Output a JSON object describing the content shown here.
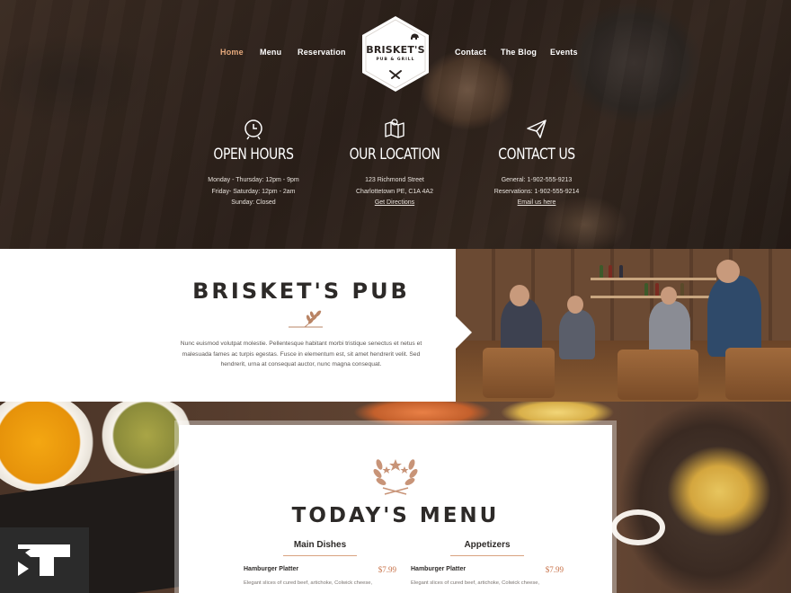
{
  "nav": {
    "left": [
      "Home",
      "Menu",
      "Reservation"
    ],
    "right": [
      "Contact",
      "The Blog",
      "Events"
    ]
  },
  "logo": {
    "name": "BRISKET'S",
    "tagline": "PUB & GRILL"
  },
  "info": [
    {
      "icon": "clock-icon",
      "title": "OPEN HOURS",
      "lines": [
        "Monday - Thursday: 12pm - 9pm",
        "Friday- Saturday: 12pm - 2am",
        "Sunday: Closed"
      ],
      "link": ""
    },
    {
      "icon": "map-icon",
      "title": "OUR LOCATION",
      "lines": [
        "123 Richmond Street",
        "Charlottetown PE, C1A 4A2"
      ],
      "link": "Get Directions"
    },
    {
      "icon": "paper-plane-icon",
      "title": "CONTACT US",
      "lines": [
        "General: 1-902-555-9213",
        "Reservations: 1-902-555-9214"
      ],
      "link": "Email us here"
    }
  ],
  "about": {
    "title": "BRISKET'S PUB",
    "body": "Nunc euismod volutpat molestie. Pellentesque habitant morbi tristique senectus et netus et malesuada fames ac turpis egestas. Fusce in elementum est, sit amet hendrerit velit. Sed hendrerit, urna at consequat auctor, nunc magna consequat."
  },
  "menu": {
    "title": "TODAY'S MENU",
    "columns": [
      {
        "title": "Main Dishes",
        "items": [
          {
            "name": "Hamburger Platter",
            "price": "$7.99",
            "desc": "Elegant slices of cured beef, artichoke, Colwick cheese,"
          }
        ]
      },
      {
        "title": "Appetizers",
        "items": [
          {
            "name": "Hamburger Platter",
            "price": "$7.99",
            "desc": "Elegant slices of cured beef, artichoke, Colwick cheese,"
          }
        ]
      }
    ]
  },
  "colors": {
    "accent": "#e6a97c",
    "price": "#c8734a",
    "dark": "#2d2a28"
  }
}
